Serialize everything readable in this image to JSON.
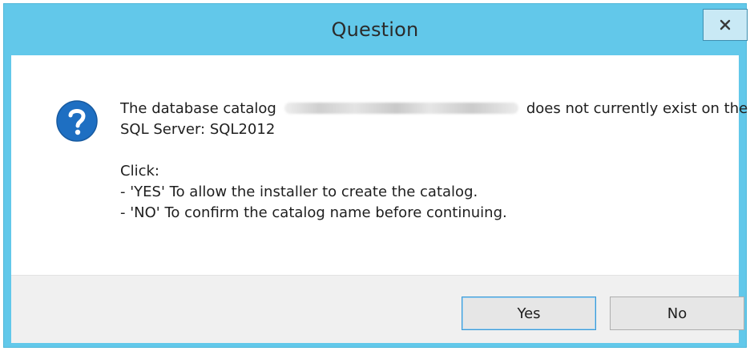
{
  "dialog": {
    "title": "Question",
    "close_label": "x",
    "icon": "question-icon",
    "message": {
      "line1_before": "The database catalog",
      "line1_after": "does not currently exist on the",
      "line2": "SQL Server: SQL2012",
      "line3": "Click:",
      "line4": "- 'YES' To allow the installer to create the catalog.",
      "line5": "- 'NO' To confirm the catalog name before continuing."
    },
    "buttons": {
      "yes": "Yes",
      "no": "No"
    }
  },
  "colors": {
    "titlebar": "#62c8ea",
    "icon_blue": "#1e6fc2"
  }
}
